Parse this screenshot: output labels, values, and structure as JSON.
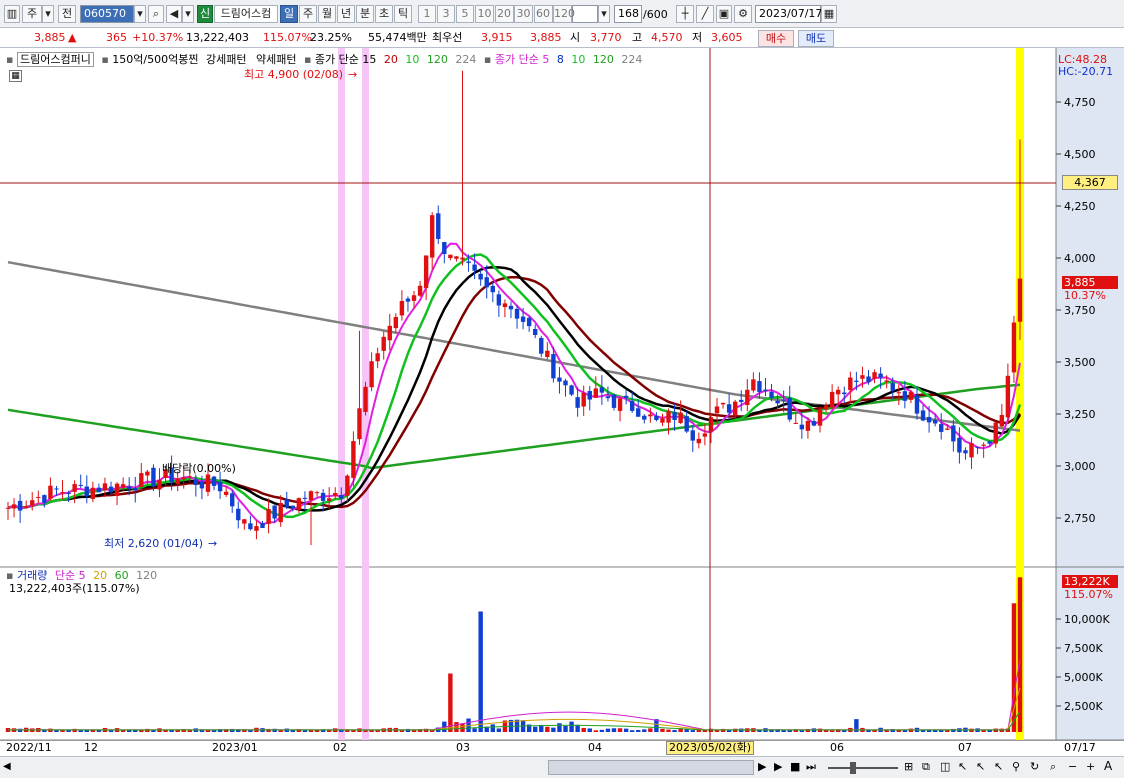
{
  "toolbar": {
    "market_1": "주",
    "market_2": "전",
    "code": "060570",
    "badge": "신",
    "name": "드림어스컴",
    "periods": [
      "일",
      "주",
      "월",
      "년",
      "분",
      "초",
      "틱"
    ],
    "active_period": "일",
    "intervals": [
      "1",
      "3",
      "5",
      "10",
      "20",
      "30",
      "60",
      "120"
    ],
    "count": "168",
    "count_total": "/600",
    "date": "2023/07/17"
  },
  "quote": {
    "price": "3,885",
    "arrow": "▲",
    "change": "365",
    "change_pct": "+10.37%",
    "volume": "13,222,403",
    "volume_pct": "115.07%",
    "turnover": "23.25%",
    "amount": "55,474백만",
    "best_label": "최우선",
    "best_ask": "3,915",
    "best_bid": "3,885",
    "open_label": "시",
    "open": "3,770",
    "high_label": "고",
    "high": "4,570",
    "low_label": "저",
    "low": "3,605",
    "buy": "매수",
    "sell": "매도"
  },
  "legend": {
    "stock": "드림어스컴퍼니",
    "pattern": "150억/500억봉찐",
    "strong": "강세패턴",
    "weak": "약세패턴",
    "ma_label": "종가 단순",
    "ma1": "15",
    "ma2": "20",
    "ma3": "10",
    "ma4": "120",
    "ma5": "224",
    "ma_label2": "종가 단순",
    "ma6": "5",
    "ma7": "8",
    "ma8": "10",
    "ma9": "120",
    "ma10": "224"
  },
  "annotations": {
    "high": "최고 4,900 (02/08)",
    "low": "최저 2,620 (01/04)",
    "dividend": "배당락(0.00%)",
    "lc": "LC:48.28",
    "hc": "HC:-20.71",
    "crosshair_price": "4,367",
    "last_price": "3,885",
    "last_pct": "10.37%"
  },
  "volume_legend": {
    "title": "거래량",
    "ma_label": "단순",
    "p1": "5",
    "p2": "20",
    "p3": "60",
    "p4": "120",
    "current": "13,222,403주(115.07%)",
    "tag": "13,222K",
    "tag_pct": "115.07%"
  },
  "chart_data": {
    "type": "candlestick",
    "price_axis": [
      "4,750",
      "4,500",
      "4,250",
      "4,000",
      "3,750",
      "3,500",
      "3,250",
      "3,000",
      "2,750"
    ],
    "volume_axis": [
      "10,000K",
      "7,500K",
      "5,000K",
      "2,500K"
    ],
    "x_labels": [
      "2022/11",
      "12",
      "2023/01",
      "02",
      "03",
      "04",
      "2023/05/02(화)",
      "06",
      "07",
      "07/17"
    ],
    "ylim": [
      2600,
      4950
    ],
    "annotated_high": 4900,
    "annotated_low": 2620,
    "last_close": 3885,
    "last_volume_k": 13222
  },
  "colors": {
    "up": "#e01010",
    "down": "#1040d0",
    "ma_short": "#e020e0",
    "ma_green": "#10c020",
    "ma_black": "#000000",
    "ma_dark_red": "#800000",
    "ma_long_green": "#20a020",
    "ma_gray": "#808080",
    "highlight_pink": "#f6c4f6",
    "highlight_yellow": "#ffff00"
  }
}
